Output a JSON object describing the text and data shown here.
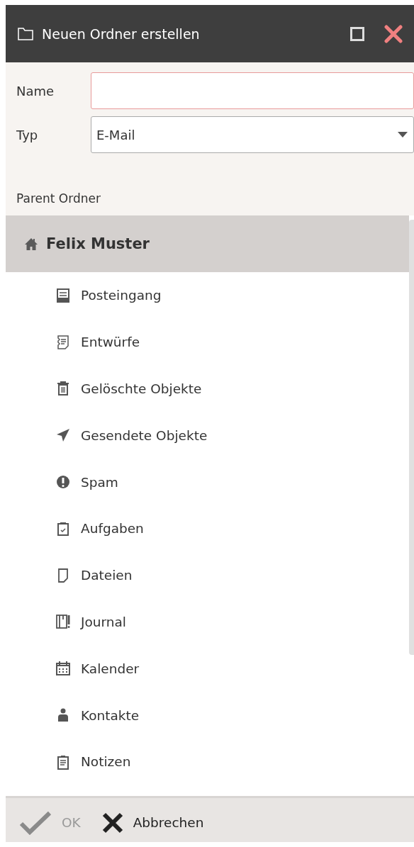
{
  "window": {
    "title": "Neuen Ordner erstellen"
  },
  "form": {
    "name": {
      "label": "Name",
      "invalid": true
    },
    "type": {
      "label": "Typ",
      "value": "E-Mail"
    }
  },
  "parent_label": "Parent Ordner",
  "tree": {
    "label": "Felix Muster",
    "selected": true,
    "children": [
      {
        "label": "Posteingang",
        "kind": "inbox",
        "selected": false
      },
      {
        "label": "Entwürfe",
        "kind": "drafts",
        "selected": false
      },
      {
        "label": "Gelöschte Objekte",
        "kind": "deleted",
        "selected": false
      },
      {
        "label": "Gesendete Objekte",
        "kind": "sent",
        "selected": false
      },
      {
        "label": "Spam",
        "kind": "spam",
        "selected": false
      },
      {
        "label": "Aufgaben",
        "kind": "tasks",
        "selected": false
      },
      {
        "label": "Dateien",
        "kind": "files",
        "selected": false
      },
      {
        "label": "Journal",
        "kind": "journal",
        "selected": false
      },
      {
        "label": "Kalender",
        "kind": "calendar",
        "selected": false
      },
      {
        "label": "Kontakte",
        "kind": "contacts",
        "selected": false
      },
      {
        "label": "Notizen",
        "kind": "notes",
        "selected": false
      }
    ]
  },
  "buttons": [
    {
      "label": "OK",
      "kind": "ok",
      "disabled": true
    },
    {
      "label": "Abbrechen",
      "kind": "cancel",
      "disabled": false
    }
  ]
}
